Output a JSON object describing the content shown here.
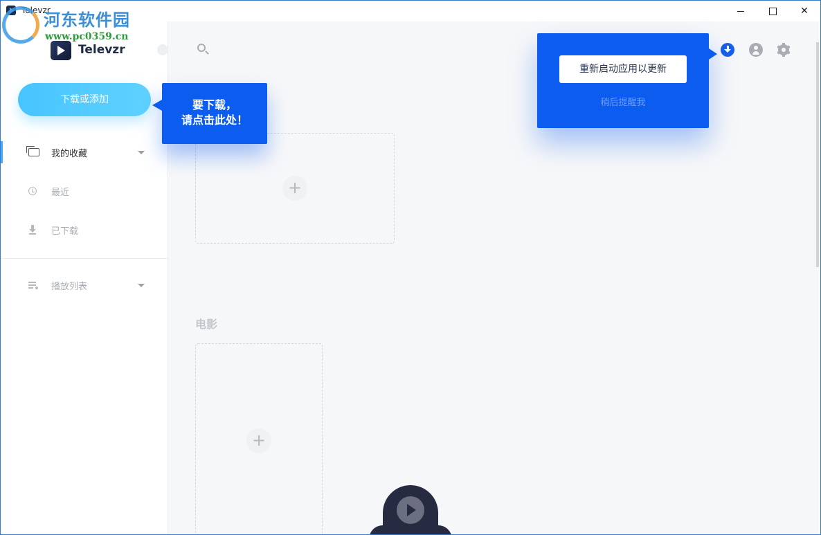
{
  "window": {
    "title": "Televzr",
    "min_label": "",
    "max_label": "",
    "close_label": "✕"
  },
  "watermark": {
    "site_name": "河东软件园",
    "url": "www.pc0359.cn"
  },
  "sidebar": {
    "brand": "Televzr",
    "download_button": "下载或添加",
    "items": [
      {
        "label": "我的收藏",
        "icon": "folder-icon",
        "active": true,
        "has_chevron": true
      },
      {
        "label": "最近",
        "icon": "clock-icon",
        "active": false,
        "has_chevron": false
      },
      {
        "label": "已下载",
        "icon": "download-icon",
        "active": false,
        "has_chevron": false
      },
      {
        "label": "播放列表",
        "icon": "playlist-icon",
        "active": false,
        "has_chevron": true
      }
    ]
  },
  "main": {
    "section_movies": "电影",
    "add_symbol": "+"
  },
  "tooltip": {
    "line1": "要下载，",
    "line2": "请点击此处！"
  },
  "update_popup": {
    "restart_label": "重新启动应用以更新",
    "later_label": "稍后提醒我"
  },
  "colors": {
    "accent": "#0c5cf0",
    "download_button": "#47c4ff",
    "player_bar": "#262b42"
  }
}
